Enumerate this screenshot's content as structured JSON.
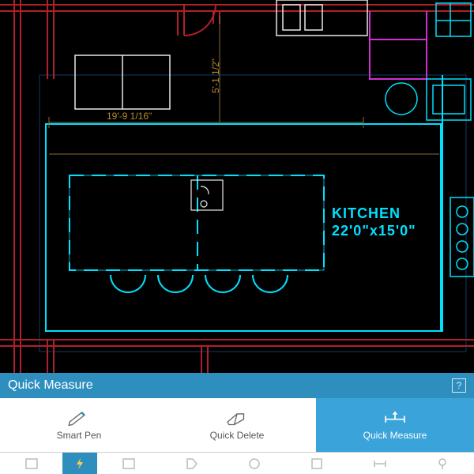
{
  "canvas": {
    "room_label_name": "KITCHEN",
    "room_label_dims": "22'0\"x15'0\"",
    "dim_horizontal": "19'-9 1/16\"",
    "dim_vertical": "5'-1 1/2\"",
    "colors": {
      "wall_red": "#b0202a",
      "fixture_cyan": "#00e0ff",
      "dim_olive": "#b58b2b",
      "inner_line": "#8a6d3b",
      "magenta": "#d030d0",
      "white": "#e8e8e8",
      "grid_blue": "#0f3a66"
    }
  },
  "panel": {
    "title": "Quick Measure",
    "help_label": "?",
    "tools": [
      {
        "label": "Smart Pen",
        "active": false
      },
      {
        "label": "Quick Delete",
        "active": false
      },
      {
        "label": "Quick Measure",
        "active": true
      }
    ]
  }
}
